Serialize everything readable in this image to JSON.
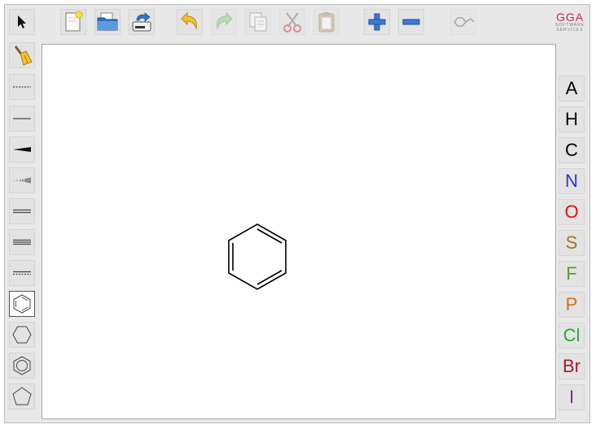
{
  "toolbar": {
    "tools": [
      "pointer",
      "new-document",
      "open",
      "save",
      "undo",
      "redo",
      "copy",
      "cut",
      "paste",
      "zoom-in",
      "zoom-out",
      "template"
    ]
  },
  "logo": {
    "mark": "GGA",
    "sub1": "SOFTWARE",
    "sub2": "SERVICES"
  },
  "left_tools": [
    "clear",
    "single-bond-any",
    "single-bond",
    "wedge-up-bond",
    "wedge-down-bond",
    "double-bond",
    "triple-bond",
    "aromatic-bond",
    "benzene-ring",
    "cyclohexane-ring",
    "aromatic-ring",
    "cyclopentane-ring"
  ],
  "selected_tool": "benzene-ring",
  "atoms": [
    {
      "symbol": "A",
      "color": "#000000"
    },
    {
      "symbol": "H",
      "color": "#000000"
    },
    {
      "symbol": "C",
      "color": "#000000"
    },
    {
      "symbol": "N",
      "color": "#3030e8"
    },
    {
      "symbol": "O",
      "color": "#e81010"
    },
    {
      "symbol": "S",
      "color": "#9c7a1c"
    },
    {
      "symbol": "F",
      "color": "#5a9a2a"
    },
    {
      "symbol": "P",
      "color": "#d27010"
    },
    {
      "symbol": "Cl",
      "color": "#20b020"
    },
    {
      "symbol": "Br",
      "color": "#a0202a"
    },
    {
      "symbol": "I",
      "color": "#8a209a"
    }
  ],
  "canvas": {
    "molecule": "benzene"
  }
}
